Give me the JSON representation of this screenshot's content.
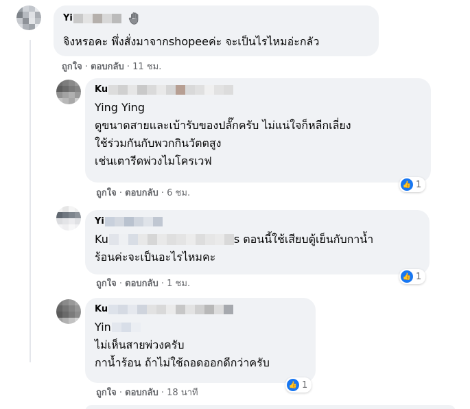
{
  "comments": [
    {
      "author_visible": "Yi",
      "text_lines": [
        "จิงหรอคะ พึ่งสั่งมาจากshopeeค่ะ จะเป็นไรไหมอ่ะกลัว"
      ],
      "like_label": "ถูกใจ",
      "reply_label": "ตอบกลับ",
      "time": "11 ชม.",
      "has_wave": true,
      "reaction_count": ""
    },
    {
      "author_visible": "Ku",
      "mention_visible": "Ying Ying",
      "text_lines": [
        "ดูขนาดสายและเบ้ารับของปลั๊กครับ ไม่แน่ใจก็หลีกเลี่ยง",
        "ใช้ร่วมกันกับพวกกินวัตตสูง",
        "เช่นเตารีดพ่วงไมโครเวฟ"
      ],
      "like_label": "ถูกใจ",
      "reply_label": "ตอบกลับ",
      "time": "6 ชม.",
      "reaction_count": "1"
    },
    {
      "author_visible": "Yi",
      "mention_visible": "Ku",
      "text_lines_first_suffix": "s ตอนนี้ใช้เสียบตู้เย็นกับกาน้ำ",
      "text_lines": [
        "ร้อนค่ะจะเป็นอะไรไหมคะ"
      ],
      "like_label": "ถูกใจ",
      "reply_label": "ตอบกลับ",
      "time": "1 ชม.",
      "reaction_count": "1"
    },
    {
      "author_visible": "Ku",
      "mention_visible": "Yin",
      "text_lines": [
        "ไม่เห็นสายพ่วงครับ",
        "กาน้ำร้อน ถ้าไม่ใช้ถอดออกดีกว่าครับ"
      ],
      "like_label": "ถูกใจ",
      "reply_label": "ตอบกลับ",
      "time": "18 นาที",
      "reaction_count": "1"
    }
  ],
  "separator": "·",
  "colors": {
    "bubble": "#f0f2f5",
    "meta": "#65676b",
    "like": "#1877f2"
  },
  "icons": {
    "wave": "waving-hand-icon",
    "like": "like-thumb-icon"
  }
}
